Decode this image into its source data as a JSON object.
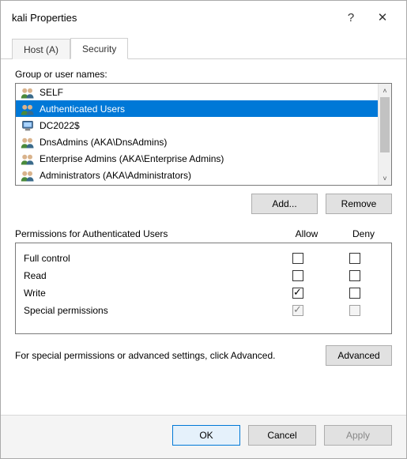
{
  "title": "kali Properties",
  "titlebar": {
    "help": "?",
    "close": "✕"
  },
  "tabs": [
    {
      "label": "Host (A)",
      "active": false
    },
    {
      "label": "Security",
      "active": true
    }
  ],
  "group_label": "Group or user names:",
  "groups": [
    {
      "icon": "users-icon",
      "label": "SELF",
      "selected": false
    },
    {
      "icon": "users-icon",
      "label": "Authenticated Users",
      "selected": true
    },
    {
      "icon": "computer-icon",
      "label": "DC2022$",
      "selected": false
    },
    {
      "icon": "users-icon",
      "label": "DnsAdmins (AKA\\DnsAdmins)",
      "selected": false
    },
    {
      "icon": "users-icon",
      "label": "Enterprise Admins (AKA\\Enterprise Admins)",
      "selected": false
    },
    {
      "icon": "users-icon",
      "label": "Administrators (AKA\\Administrators)",
      "selected": false
    }
  ],
  "buttons": {
    "add": "Add...",
    "remove": "Remove",
    "advanced": "Advanced",
    "ok": "OK",
    "cancel": "Cancel",
    "apply": "Apply"
  },
  "perm_header": {
    "label": "Permissions for Authenticated Users",
    "allow": "Allow",
    "deny": "Deny"
  },
  "permissions": [
    {
      "label": "Full control",
      "allow": false,
      "deny": false,
      "disabled": false
    },
    {
      "label": "Read",
      "allow": false,
      "deny": false,
      "disabled": false
    },
    {
      "label": "Write",
      "allow": true,
      "deny": false,
      "disabled": false
    },
    {
      "label": "Special permissions",
      "allow": true,
      "deny": false,
      "disabled": true
    }
  ],
  "advanced_text": "For special permissions or advanced settings, click Advanced."
}
